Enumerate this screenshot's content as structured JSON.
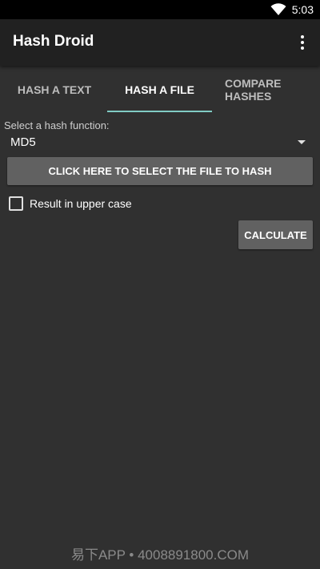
{
  "status_bar": {
    "time": "5:03",
    "icons": [
      "wifi-icon"
    ]
  },
  "app_bar": {
    "title": "Hash Droid",
    "menu_icon": "overflow-menu-icon"
  },
  "tabs": [
    {
      "label": "HASH A TEXT",
      "selected": false
    },
    {
      "label": "HASH A FILE",
      "selected": true
    },
    {
      "label": "COMPARE HASHES",
      "selected": false
    }
  ],
  "form": {
    "hash_function_label": "Select a hash function:",
    "hash_function_value": "MD5",
    "select_file_label": "CLICK HERE TO SELECT THE FILE TO HASH",
    "uppercase_label": "Result in upper case",
    "uppercase_checked": false,
    "calculate_label": "CALCULATE"
  },
  "watermark": "易下APP • 4008891800.COM",
  "colors": {
    "background": "#303030",
    "app_bar": "#212121",
    "tab_indicator": "#80cbc4",
    "button": "#616161"
  }
}
